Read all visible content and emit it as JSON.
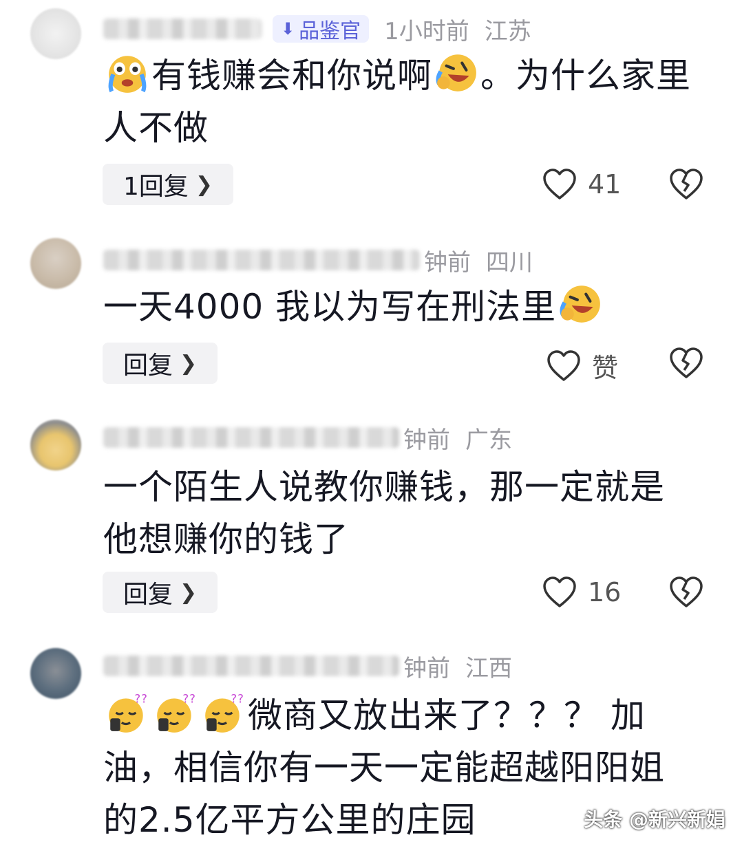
{
  "comments": [
    {
      "badge": "品鉴官",
      "time": "1小时前",
      "location": "江苏",
      "text_a": "有钱赚会和你说啊",
      "text_b": "。为什么家里人不做",
      "reply_label": "1回复",
      "likes": "41"
    },
    {
      "time": "钟前",
      "location": "四川",
      "text_a": "一天4000 我以为写在刑法里",
      "reply_label": "回复",
      "likes": "赞"
    },
    {
      "time": "钟前",
      "location": "广东",
      "text_a": "一个陌生人说教你赚钱，那一定就是他想赚你的钱了",
      "reply_label": "回复",
      "likes": "16"
    },
    {
      "time": "钟前",
      "location": "江西",
      "text_a": "微商又放出来了？？？ 加油，相信你有一天一定能超越阳阳姐的2.5亿平方公里的庄园"
    }
  ],
  "watermark": "头条 @新兴新娟",
  "icons": {
    "like": "heart-outline-icon",
    "dislike": "broken-heart-icon",
    "chevron": "chevron-right-icon",
    "emoji_crying": "crying-face-emoji",
    "emoji_laughing": "laugh-cry-emoji",
    "emoji_sleepy": "sleepy-face-emoji"
  }
}
